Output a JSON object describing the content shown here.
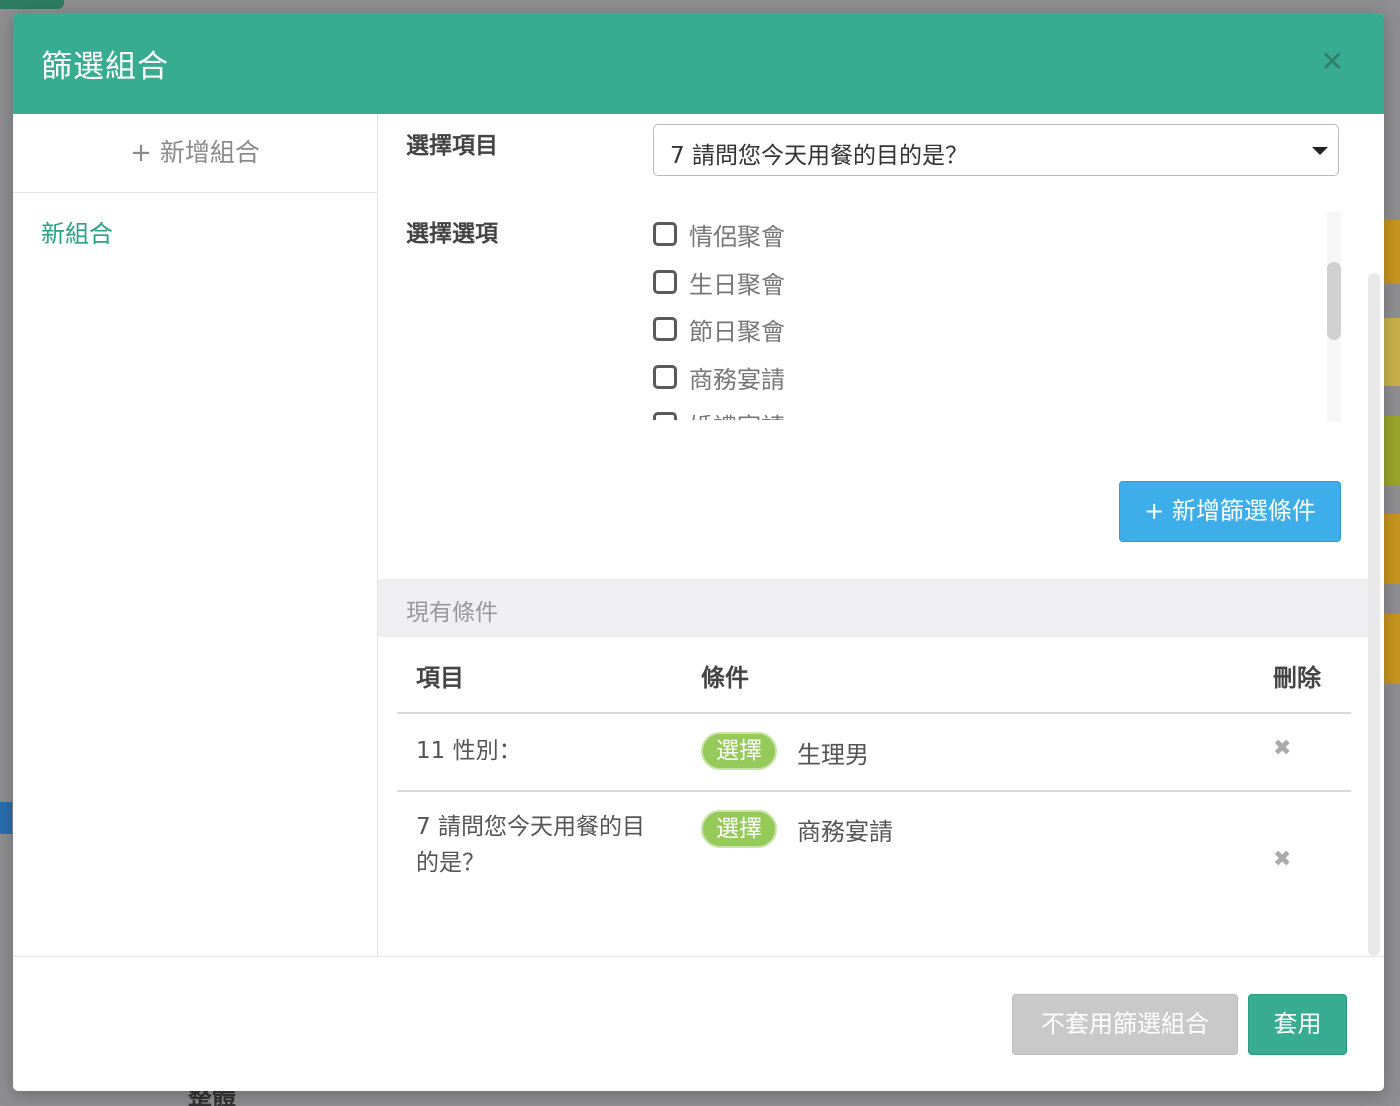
{
  "modal": {
    "title": "篩選組合",
    "close_icon": "close-icon"
  },
  "sidebar": {
    "add_group_label": "新增組合",
    "groups": [
      "新組合"
    ]
  },
  "form": {
    "select_item_label": "選擇項目",
    "select_item_value": "7 請問您今天用餐的目的是？",
    "select_options_label": "選擇選項",
    "options": [
      "情侶聚會",
      "生日聚會",
      "節日聚會",
      "商務宴請",
      "婚禮宴請"
    ],
    "add_condition_label": "+ 新增篩選條件"
  },
  "conditions": {
    "section_title": "現有條件",
    "headers": {
      "item": "項目",
      "condition": "條件",
      "delete": "刪除"
    },
    "rows": [
      {
        "item": "11 性別：",
        "badge": "選擇",
        "value": "生理男"
      },
      {
        "item": "7 請問您今天用餐的目的是？",
        "badge": "選擇",
        "value": "商務宴請"
      }
    ]
  },
  "footer": {
    "unapply_label": "不套用篩選組合",
    "apply_label": "套用"
  },
  "background": {
    "partial_text": "整體"
  },
  "colors": {
    "header": "#37ac91",
    "accent_blue": "#3daee9",
    "badge_green": "#95c95a",
    "link_green": "#2aa288"
  }
}
